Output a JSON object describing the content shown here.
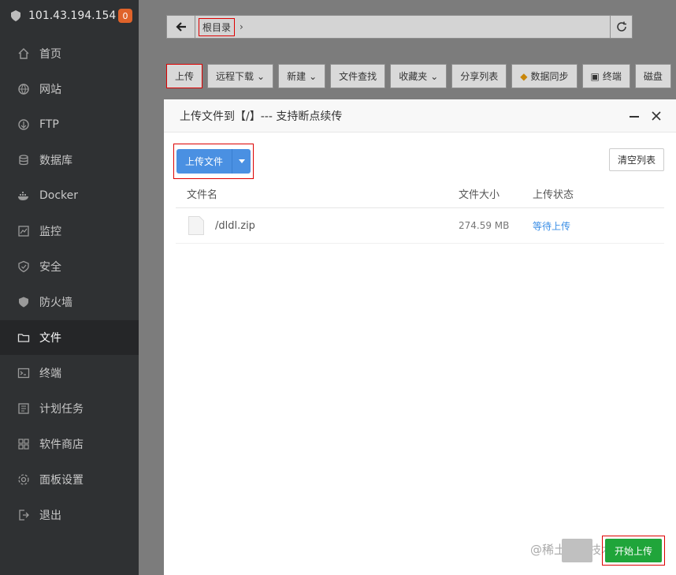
{
  "sidebar": {
    "host": "101.43.194.154",
    "badge": "0",
    "items": [
      {
        "label": "首页",
        "icon": "home-icon"
      },
      {
        "label": "网站",
        "icon": "globe-icon"
      },
      {
        "label": "FTP",
        "icon": "ftp-icon"
      },
      {
        "label": "数据库",
        "icon": "database-icon"
      },
      {
        "label": "Docker",
        "icon": "docker-icon"
      },
      {
        "label": "监控",
        "icon": "monitor-icon"
      },
      {
        "label": "安全",
        "icon": "shield-icon"
      },
      {
        "label": "防火墙",
        "icon": "firewall-icon"
      },
      {
        "label": "文件",
        "icon": "folder-icon"
      },
      {
        "label": "终端",
        "icon": "terminal-icon"
      },
      {
        "label": "计划任务",
        "icon": "schedule-icon"
      },
      {
        "label": "软件商店",
        "icon": "apps-icon"
      },
      {
        "label": "面板设置",
        "icon": "settings-icon"
      },
      {
        "label": "退出",
        "icon": "logout-icon"
      }
    ],
    "active_index": 8
  },
  "pathbar": {
    "crumb": "根目录"
  },
  "toolbar": {
    "upload": "上传",
    "remote_download": "远程下载",
    "new": "新建",
    "file_search": "文件查找",
    "favorites": "收藏夹",
    "share_list": "分享列表",
    "data_sync": "数据同步",
    "terminal": "终端",
    "disk": "磁盘"
  },
  "modal": {
    "title": "上传文件到【/】--- 支持断点续传",
    "upload_file_btn": "上传文件",
    "clear_list_btn": "清空列表",
    "columns": [
      "文件名",
      "文件大小",
      "上传状态"
    ],
    "rows": [
      {
        "name": "/dldl.zip",
        "size": "274.59 MB",
        "status": "等待上传"
      }
    ],
    "start_upload_btn": "开始上传"
  },
  "watermark": "@稀土掘金技术社区"
}
